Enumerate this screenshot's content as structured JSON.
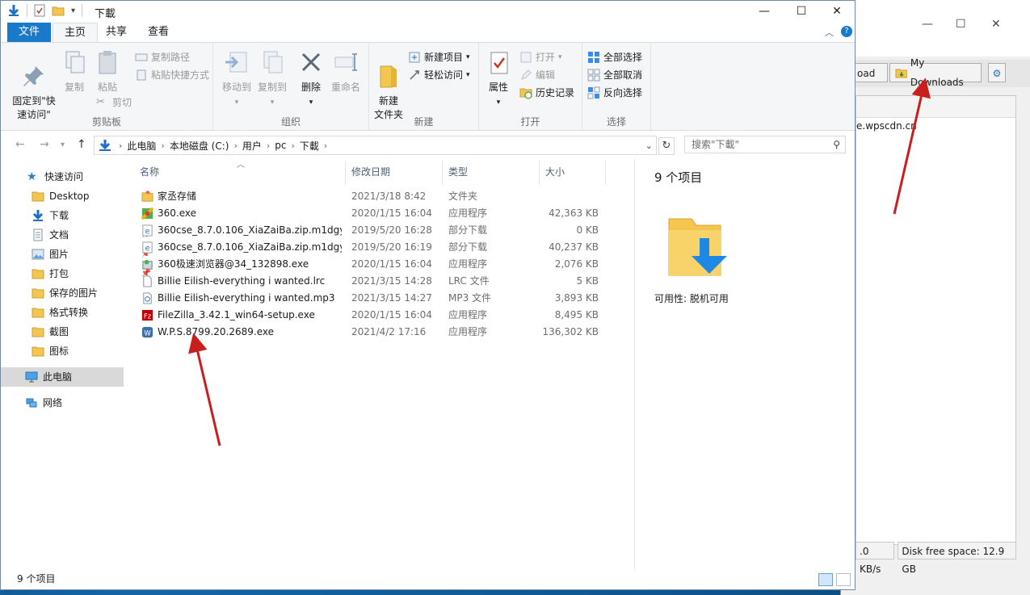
{
  "window": {
    "title": "下載",
    "controls": [
      "—",
      "☐",
      "✕"
    ]
  },
  "tabs": {
    "file": "文件",
    "home": "主页",
    "share": "共享",
    "view": "查看"
  },
  "ribbon": {
    "clipboard": {
      "label": "剪贴板",
      "pin": "固定到\"快\n速访问\"",
      "copy": "复制",
      "paste": "粘贴",
      "copy_path": "复制路径",
      "paste_shortcut": "粘贴快捷方式",
      "cut": "剪切"
    },
    "organize": {
      "label": "组织",
      "move_to": "移动到",
      "copy_to": "复制到",
      "delete": "删除",
      "rename": "重命名"
    },
    "new": {
      "label": "新建",
      "new_folder": "新建\n文件夹",
      "new_item": "新建项目",
      "easy_access": "轻松访问"
    },
    "open": {
      "label": "打开",
      "properties": "属性",
      "open": "打开",
      "edit": "编辑",
      "history": "历史记录"
    },
    "select": {
      "label": "选择",
      "select_all": "全部选择",
      "select_none": "全部取消",
      "invert": "反向选择"
    }
  },
  "address": {
    "crumbs": [
      "此电脑",
      "本地磁盘 (C:)",
      "用户",
      "pc",
      "下載"
    ],
    "search_placeholder": "搜索\"下載\""
  },
  "nav": {
    "items": [
      {
        "label": "快速访问",
        "icon": "star-icon"
      },
      {
        "label": "Desktop",
        "icon": "folder-icon"
      },
      {
        "label": "下载",
        "icon": "download-icon"
      },
      {
        "label": "文档",
        "icon": "document-icon"
      },
      {
        "label": "图片",
        "icon": "picture-icon"
      },
      {
        "label": "打包",
        "icon": "folder-icon"
      },
      {
        "label": "保存的图片",
        "icon": "folder-icon"
      },
      {
        "label": "格式转换",
        "icon": "folder-icon"
      },
      {
        "label": "截图",
        "icon": "folder-icon"
      },
      {
        "label": "图标",
        "icon": "folder-icon"
      },
      {
        "label": "此电脑",
        "icon": "computer-icon"
      },
      {
        "label": "网络",
        "icon": "network-icon"
      }
    ]
  },
  "columns": {
    "name": "名称",
    "date": "修改日期",
    "type": "类型",
    "size": "大小"
  },
  "files": [
    {
      "name": "家丞存储",
      "date": "2021/3/18 8:42",
      "type": "文件夹",
      "size": "",
      "icon": "folder-icon"
    },
    {
      "name": "360.exe",
      "date": "2020/1/15 16:04",
      "type": "应用程序",
      "size": "42,363 KB",
      "icon": "app-icon"
    },
    {
      "name": "360cse_8.7.0.106_XiaZaiBa.zip.m1dgy...",
      "date": "2019/5/20 16:28",
      "type": "部分下载",
      "size": "0 KB",
      "icon": "ie-icon"
    },
    {
      "name": "360cse_8.7.0.106_XiaZaiBa.zip.m1dgy...",
      "date": "2019/5/20 16:19",
      "type": "部分下载",
      "size": "40,237 KB",
      "icon": "ie-icon"
    },
    {
      "name": "360极速浏览器@34_132898.exe",
      "date": "2020/1/15 16:04",
      "type": "应用程序",
      "size": "2,076 KB",
      "icon": "installer-icon"
    },
    {
      "name": "Billie Eilish-everything i wanted.lrc",
      "date": "2021/3/15 14:28",
      "type": "LRC 文件",
      "size": "5 KB",
      "icon": "text-file-icon"
    },
    {
      "name": "Billie Eilish-everything i wanted.mp3",
      "date": "2021/3/15 14:27",
      "type": "MP3 文件",
      "size": "3,893 KB",
      "icon": "audio-file-icon"
    },
    {
      "name": "FileZilla_3.42.1_win64-setup.exe",
      "date": "2020/1/15 16:04",
      "type": "应用程序",
      "size": "8,495 KB",
      "icon": "filezilla-icon"
    },
    {
      "name": "W.P.S.8799.20.2689.exe",
      "date": "2021/4/2 17:16",
      "type": "应用程序",
      "size": "136,302 KB",
      "icon": "wps-icon"
    }
  ],
  "preview": {
    "count": "9 个项目",
    "availability": "可用性:   脱机可用"
  },
  "status": {
    "count": "9 个项目"
  },
  "bg_app": {
    "tab_partial": "oad",
    "my_downloads": "My Downloads",
    "url_fragment": "e.wpscdn.cn",
    "speed": ".0 KB/s",
    "disk": "Disk free space: 12.9 GB"
  },
  "colors": {
    "accent": "#1979ca",
    "arrow": "#c81e1e",
    "folder": "#f4c64f"
  }
}
